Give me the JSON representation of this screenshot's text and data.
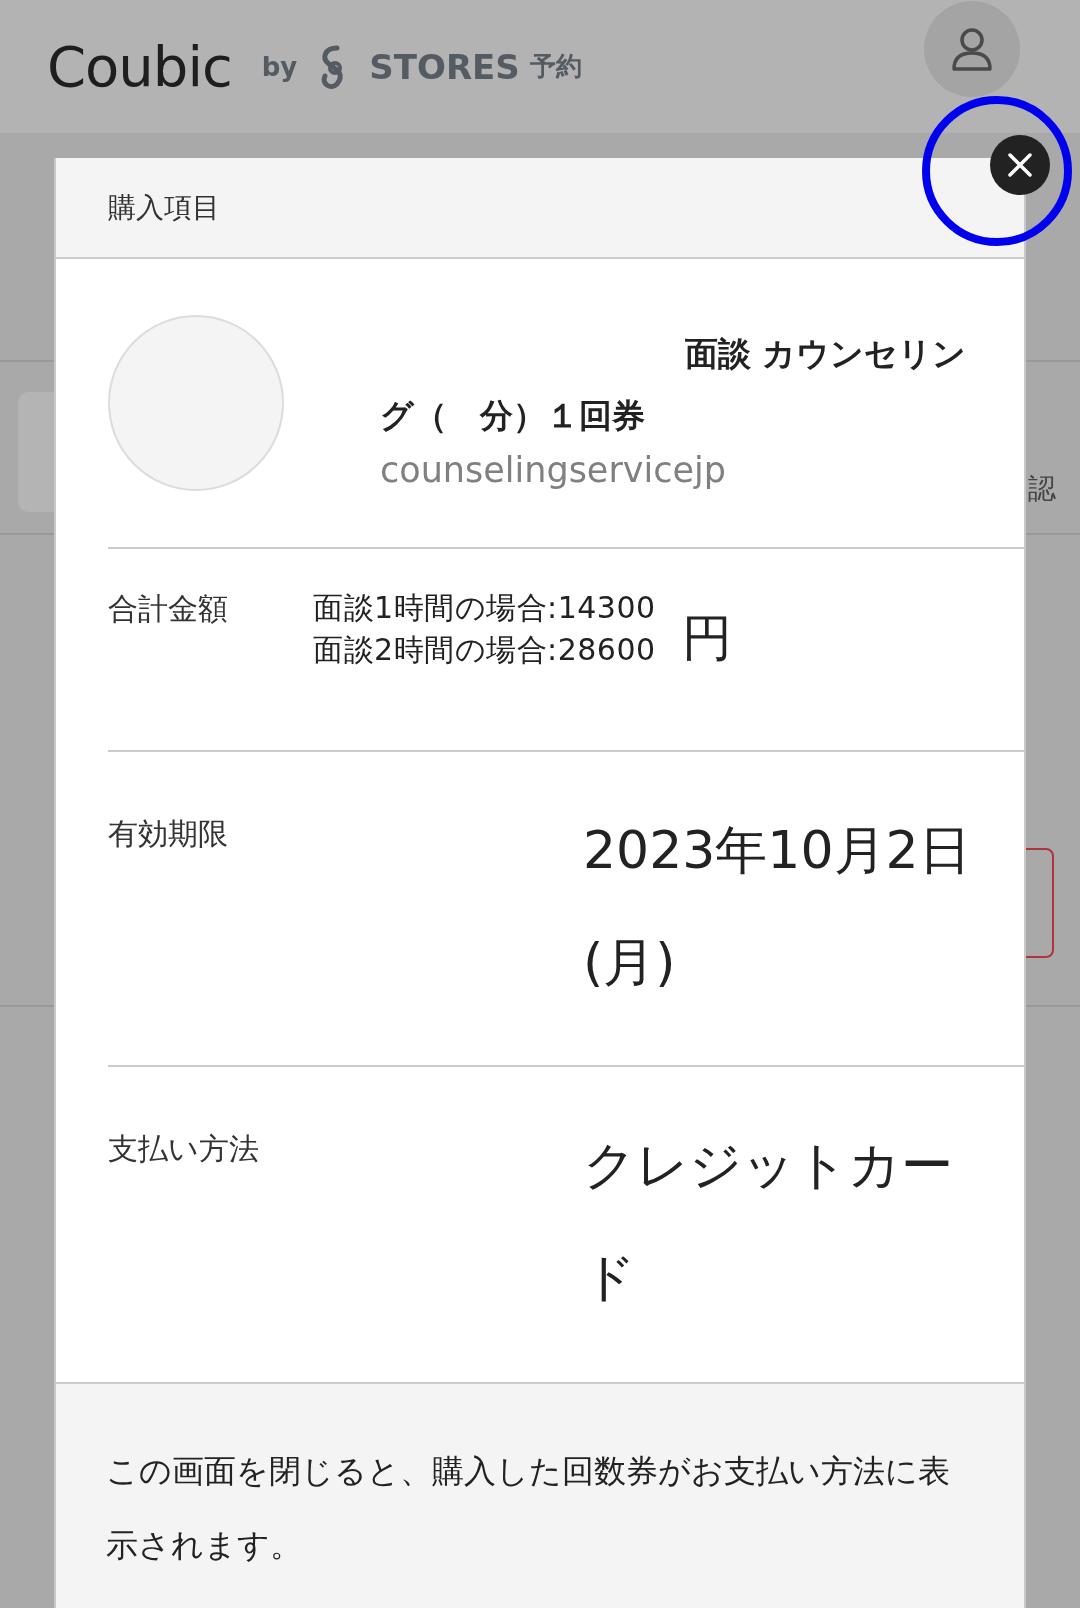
{
  "header": {
    "logo": "Coubic",
    "by": "by",
    "brand": "STORES",
    "brand_suffix": "予約"
  },
  "background_text": "認",
  "modal": {
    "title": "購入項目",
    "item": {
      "name": "面談 カウンセリング（　分）１回券",
      "shop": "counselingservicejp"
    },
    "rows": [
      {
        "kind": "price",
        "label": "合計金額",
        "lines": [
          "面談1時間の場合:14300",
          "面談2時間の場合:28600"
        ],
        "unit": "円"
      },
      {
        "kind": "value",
        "label": "有効期限",
        "value": "2023年10月2日(月)"
      },
      {
        "kind": "value",
        "label": "支払い方法",
        "value": "クレジットカード"
      }
    ],
    "note": "この画面を閉じると、購入した回数券がお支払い方法に表示されます。"
  }
}
